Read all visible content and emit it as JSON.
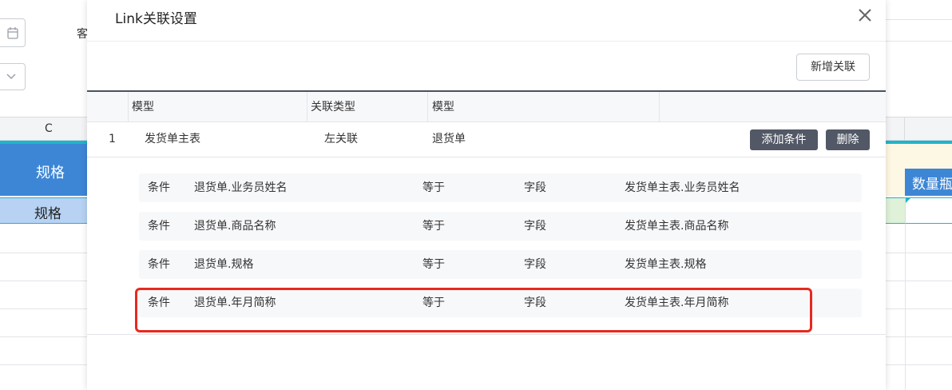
{
  "background": {
    "label_partial": "客",
    "column_header": "C",
    "header_cell": "规格",
    "row_cell": "规格",
    "right_header_cell": "数量瓶"
  },
  "modal": {
    "title": "Link关联设置",
    "add_button": "新增关联",
    "table": {
      "columns": [
        "模型",
        "关联类型",
        "模型"
      ],
      "rows": [
        {
          "index": "1",
          "model": "发货单主表",
          "link_type": "左关联",
          "target_model": "退货单",
          "add_condition": "添加条件",
          "delete": "删除"
        }
      ]
    },
    "conditions": [
      {
        "label": "条件",
        "left_field": "退货单.业务员姓名",
        "operator": "等于",
        "value_type": "字段",
        "right_field": "发货单主表.业务员姓名"
      },
      {
        "label": "条件",
        "left_field": "退货单.商品名称",
        "operator": "等于",
        "value_type": "字段",
        "right_field": "发货单主表.商品名称"
      },
      {
        "label": "条件",
        "left_field": "退货单.规格",
        "operator": "等于",
        "value_type": "字段",
        "right_field": "发货单主表.规格"
      },
      {
        "label": "条件",
        "left_field": "退货单.年月简称",
        "operator": "等于",
        "value_type": "字段",
        "right_field": "发货单主表.年月简称"
      }
    ]
  },
  "colors": {
    "accent_blue": "#3d86d6",
    "cyan": "#1fb5c9",
    "dark_button": "#525866",
    "highlight_red": "#e8291f"
  },
  "icons": {
    "date": "calendar-icon",
    "select": "chevron-down-icon",
    "close": "close-icon"
  }
}
